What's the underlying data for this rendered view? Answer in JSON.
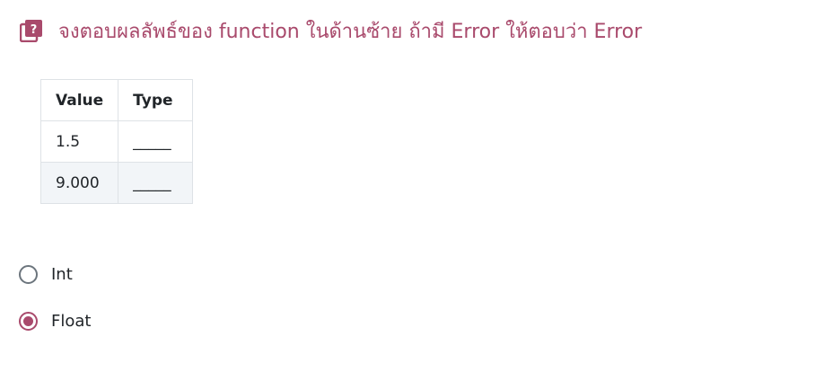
{
  "accent_color": "#a94a6c",
  "question": {
    "icon": "question-book-icon",
    "title": "จงตอบผลลัพธ์ของ function ในด้านซ้าย ถ้ามี Error ให้ตอบว่า Error"
  },
  "table": {
    "headers": [
      "Value",
      "Type"
    ],
    "rows": [
      [
        "1.5",
        "_____"
      ],
      [
        "9.000",
        "_____"
      ]
    ]
  },
  "options": [
    {
      "label": "Int",
      "selected": false
    },
    {
      "label": "Float",
      "selected": true
    }
  ]
}
